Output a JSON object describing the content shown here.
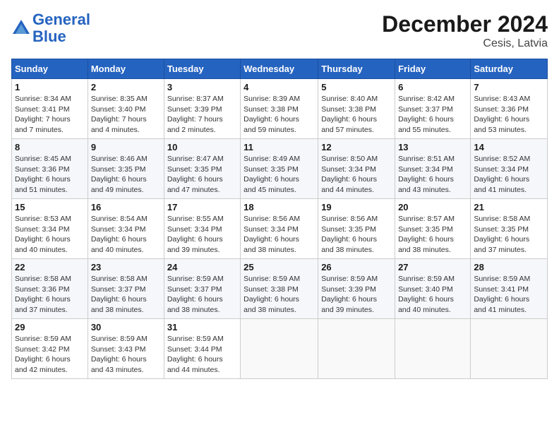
{
  "header": {
    "logo_line1": "General",
    "logo_line2": "Blue",
    "month_year": "December 2024",
    "location": "Cesis, Latvia"
  },
  "columns": [
    "Sunday",
    "Monday",
    "Tuesday",
    "Wednesday",
    "Thursday",
    "Friday",
    "Saturday"
  ],
  "weeks": [
    [
      {
        "day": "1",
        "info": "Sunrise: 8:34 AM\nSunset: 3:41 PM\nDaylight: 7 hours\nand 7 minutes."
      },
      {
        "day": "2",
        "info": "Sunrise: 8:35 AM\nSunset: 3:40 PM\nDaylight: 7 hours\nand 4 minutes."
      },
      {
        "day": "3",
        "info": "Sunrise: 8:37 AM\nSunset: 3:39 PM\nDaylight: 7 hours\nand 2 minutes."
      },
      {
        "day": "4",
        "info": "Sunrise: 8:39 AM\nSunset: 3:38 PM\nDaylight: 6 hours\nand 59 minutes."
      },
      {
        "day": "5",
        "info": "Sunrise: 8:40 AM\nSunset: 3:38 PM\nDaylight: 6 hours\nand 57 minutes."
      },
      {
        "day": "6",
        "info": "Sunrise: 8:42 AM\nSunset: 3:37 PM\nDaylight: 6 hours\nand 55 minutes."
      },
      {
        "day": "7",
        "info": "Sunrise: 8:43 AM\nSunset: 3:36 PM\nDaylight: 6 hours\nand 53 minutes."
      }
    ],
    [
      {
        "day": "8",
        "info": "Sunrise: 8:45 AM\nSunset: 3:36 PM\nDaylight: 6 hours\nand 51 minutes."
      },
      {
        "day": "9",
        "info": "Sunrise: 8:46 AM\nSunset: 3:35 PM\nDaylight: 6 hours\nand 49 minutes."
      },
      {
        "day": "10",
        "info": "Sunrise: 8:47 AM\nSunset: 3:35 PM\nDaylight: 6 hours\nand 47 minutes."
      },
      {
        "day": "11",
        "info": "Sunrise: 8:49 AM\nSunset: 3:35 PM\nDaylight: 6 hours\nand 45 minutes."
      },
      {
        "day": "12",
        "info": "Sunrise: 8:50 AM\nSunset: 3:34 PM\nDaylight: 6 hours\nand 44 minutes."
      },
      {
        "day": "13",
        "info": "Sunrise: 8:51 AM\nSunset: 3:34 PM\nDaylight: 6 hours\nand 43 minutes."
      },
      {
        "day": "14",
        "info": "Sunrise: 8:52 AM\nSunset: 3:34 PM\nDaylight: 6 hours\nand 41 minutes."
      }
    ],
    [
      {
        "day": "15",
        "info": "Sunrise: 8:53 AM\nSunset: 3:34 PM\nDaylight: 6 hours\nand 40 minutes."
      },
      {
        "day": "16",
        "info": "Sunrise: 8:54 AM\nSunset: 3:34 PM\nDaylight: 6 hours\nand 40 minutes."
      },
      {
        "day": "17",
        "info": "Sunrise: 8:55 AM\nSunset: 3:34 PM\nDaylight: 6 hours\nand 39 minutes."
      },
      {
        "day": "18",
        "info": "Sunrise: 8:56 AM\nSunset: 3:34 PM\nDaylight: 6 hours\nand 38 minutes."
      },
      {
        "day": "19",
        "info": "Sunrise: 8:56 AM\nSunset: 3:35 PM\nDaylight: 6 hours\nand 38 minutes."
      },
      {
        "day": "20",
        "info": "Sunrise: 8:57 AM\nSunset: 3:35 PM\nDaylight: 6 hours\nand 38 minutes."
      },
      {
        "day": "21",
        "info": "Sunrise: 8:58 AM\nSunset: 3:35 PM\nDaylight: 6 hours\nand 37 minutes."
      }
    ],
    [
      {
        "day": "22",
        "info": "Sunrise: 8:58 AM\nSunset: 3:36 PM\nDaylight: 6 hours\nand 37 minutes."
      },
      {
        "day": "23",
        "info": "Sunrise: 8:58 AM\nSunset: 3:37 PM\nDaylight: 6 hours\nand 38 minutes."
      },
      {
        "day": "24",
        "info": "Sunrise: 8:59 AM\nSunset: 3:37 PM\nDaylight: 6 hours\nand 38 minutes."
      },
      {
        "day": "25",
        "info": "Sunrise: 8:59 AM\nSunset: 3:38 PM\nDaylight: 6 hours\nand 38 minutes."
      },
      {
        "day": "26",
        "info": "Sunrise: 8:59 AM\nSunset: 3:39 PM\nDaylight: 6 hours\nand 39 minutes."
      },
      {
        "day": "27",
        "info": "Sunrise: 8:59 AM\nSunset: 3:40 PM\nDaylight: 6 hours\nand 40 minutes."
      },
      {
        "day": "28",
        "info": "Sunrise: 8:59 AM\nSunset: 3:41 PM\nDaylight: 6 hours\nand 41 minutes."
      }
    ],
    [
      {
        "day": "29",
        "info": "Sunrise: 8:59 AM\nSunset: 3:42 PM\nDaylight: 6 hours\nand 42 minutes."
      },
      {
        "day": "30",
        "info": "Sunrise: 8:59 AM\nSunset: 3:43 PM\nDaylight: 6 hours\nand 43 minutes."
      },
      {
        "day": "31",
        "info": "Sunrise: 8:59 AM\nSunset: 3:44 PM\nDaylight: 6 hours\nand 44 minutes."
      },
      null,
      null,
      null,
      null
    ]
  ]
}
